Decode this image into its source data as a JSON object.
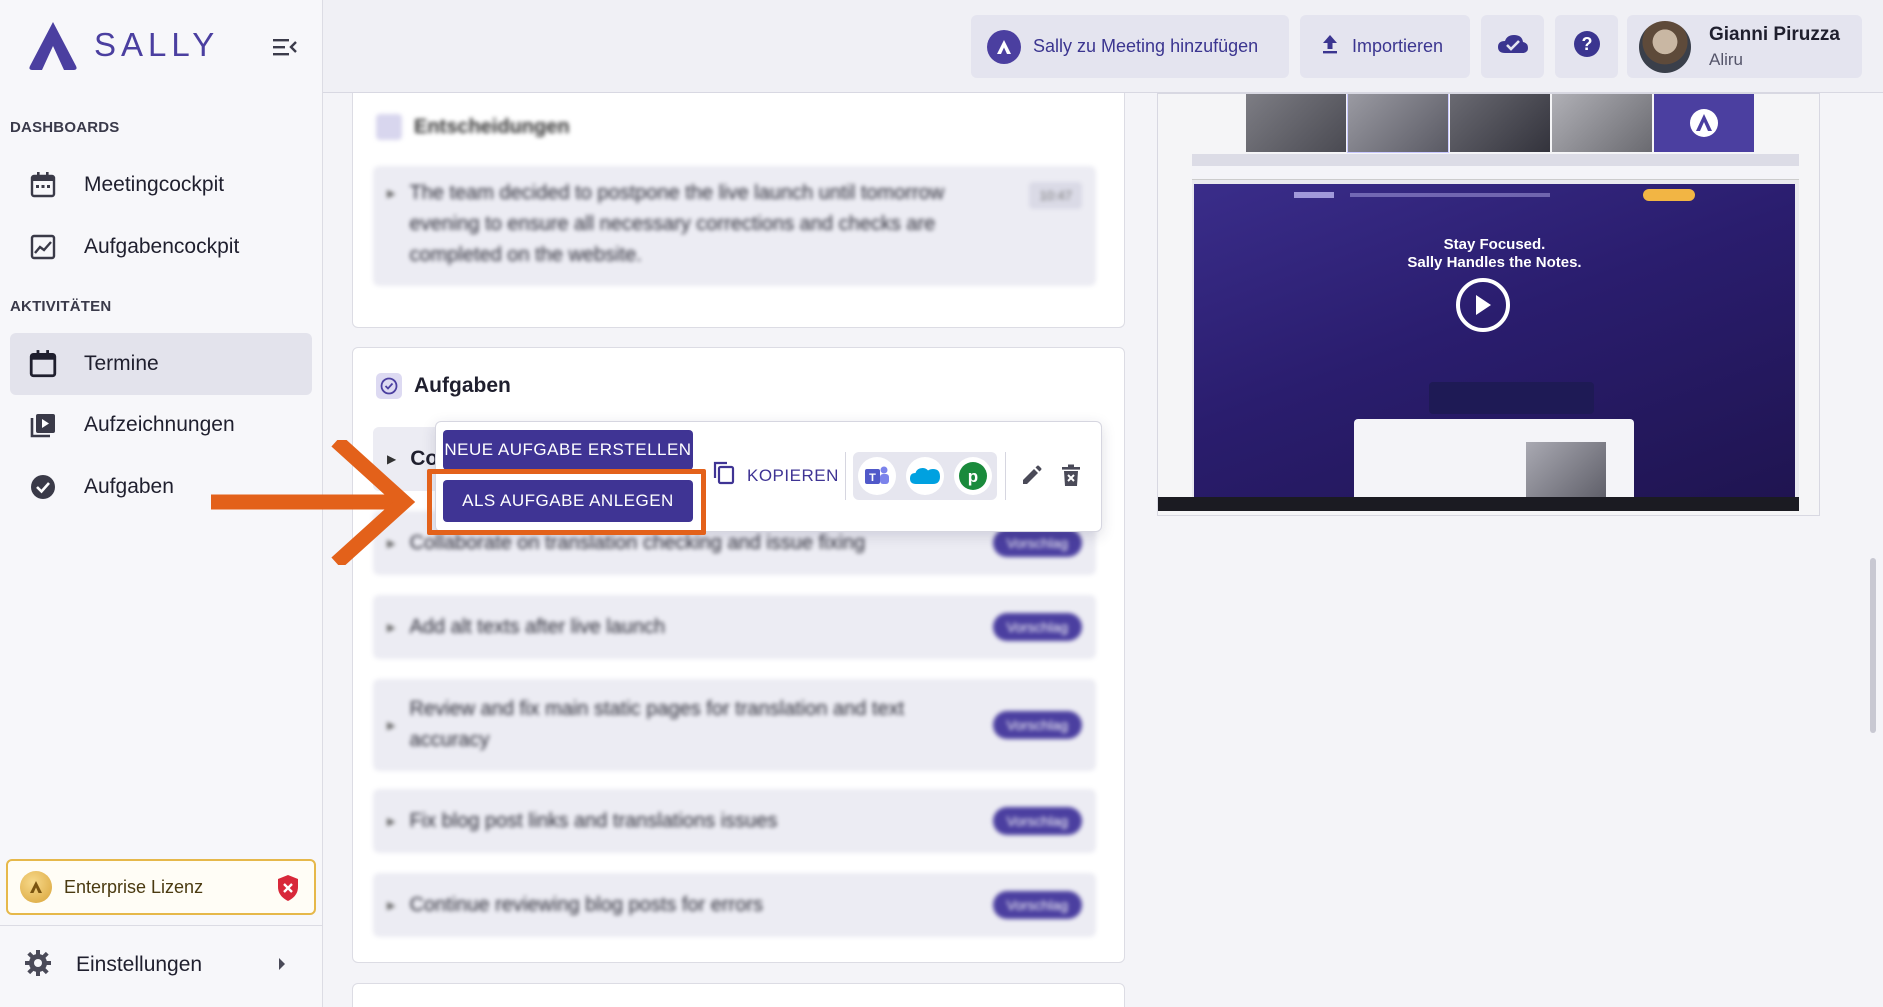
{
  "app": {
    "logo_text": "SALLY"
  },
  "sidebar": {
    "section_dashboards": "DASHBOARDS",
    "section_activities": "AKTIVITÄTEN",
    "items": [
      {
        "label": "Meetingcockpit",
        "icon": "calendar-icon"
      },
      {
        "label": "Aufgabencockpit",
        "icon": "chart-icon"
      },
      {
        "label": "Termine",
        "icon": "calendar-icon",
        "active": true
      },
      {
        "label": "Aufzeichnungen",
        "icon": "video-library-icon"
      },
      {
        "label": "Aufgaben",
        "icon": "check-circle-icon"
      }
    ],
    "license_label": "Enterprise Lizenz",
    "settings_label": "Einstellungen"
  },
  "header": {
    "add_meeting_label": "Sally zu Meeting hinzufügen",
    "import_label": "Importieren",
    "user_name": "Gianni Piruzza",
    "user_org": "Aliru"
  },
  "decisions": {
    "title": "Entscheidungen",
    "text": "The team decided to postpone the live launch until tomorrow evening to ensure all necessary corrections and checks are completed on the website.",
    "time": "10:47"
  },
  "tasks": {
    "title": "Aufgaben",
    "first_row_prefix": "Co",
    "badge": "Vorschlag",
    "rows": [
      "Collaborate on translation checking and issue fixing",
      "Add alt texts after live launch",
      "Review and fix main static pages for translation and text accuracy",
      "Fix blog post links and translations issues",
      "Continue reviewing blog posts for errors"
    ]
  },
  "popup": {
    "new_task_label": "NEUE AUFGABE ERSTELLEN",
    "create_as_task_label": "ALS AUFGABE ANLEGEN",
    "copy_label": "KOPIEREN"
  },
  "video": {
    "headline_1": "Stay Focused.",
    "headline_2": "Sally Handles the Notes."
  },
  "colors": {
    "brand": "#4b3fa0",
    "button_dark": "#3f3494",
    "highlight": "#e3611a",
    "license_border": "#e6b84a"
  }
}
